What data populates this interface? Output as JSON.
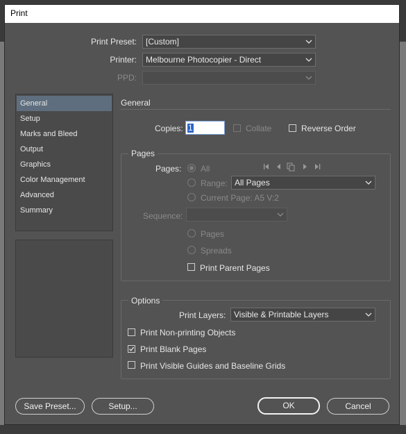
{
  "window": {
    "title": "Print"
  },
  "top": {
    "preset_label": "Print Preset:",
    "preset_value": "[Custom]",
    "printer_label": "Printer:",
    "printer_value": "Melbourne Photocopier - Direct",
    "ppd_label": "PPD:",
    "ppd_value": ""
  },
  "sidebar": {
    "items": [
      {
        "label": "General"
      },
      {
        "label": "Setup"
      },
      {
        "label": "Marks and Bleed"
      },
      {
        "label": "Output"
      },
      {
        "label": "Graphics"
      },
      {
        "label": "Color Management"
      },
      {
        "label": "Advanced"
      },
      {
        "label": "Summary"
      }
    ],
    "selected_index": 0
  },
  "general": {
    "title": "General",
    "copies_label": "Copies:",
    "copies_value": "1",
    "collate_label": "Collate",
    "collate_checked": false,
    "reverse_label": "Reverse Order",
    "reverse_checked": false
  },
  "pages": {
    "group_title": "Pages",
    "pages_label": "Pages:",
    "all_label": "All",
    "range_label": "Range:",
    "range_value": "All Pages",
    "current_page_label": "Current Page: A5 V:2",
    "sequence_label": "Sequence:",
    "sequence_value": "",
    "pages_option": "Pages",
    "spreads_option": "Spreads",
    "print_parent_label": "Print Parent Pages",
    "print_parent_checked": false
  },
  "options": {
    "group_title": "Options",
    "print_layers_label": "Print Layers:",
    "print_layers_value": "Visible & Printable Layers",
    "non_printing_label": "Print Non-printing Objects",
    "non_printing_checked": false,
    "blank_pages_label": "Print Blank Pages",
    "blank_pages_checked": true,
    "guides_label": "Print Visible Guides and Baseline Grids",
    "guides_checked": false
  },
  "buttons": {
    "save_preset": "Save Preset...",
    "setup": "Setup...",
    "ok": "OK",
    "cancel": "Cancel"
  }
}
